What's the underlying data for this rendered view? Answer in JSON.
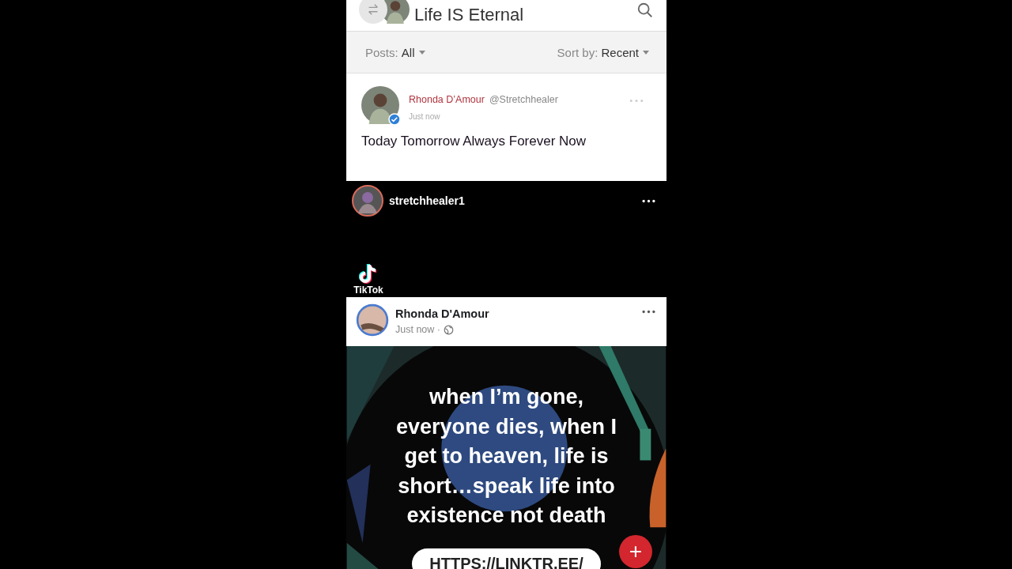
{
  "header": {
    "title": "Life IS Eternal"
  },
  "filters": [
    {
      "label": "Posts:",
      "value": "All"
    },
    {
      "label": "Sort by:",
      "value": "Recent"
    }
  ],
  "post": {
    "author": "Rhonda D’Amour",
    "handle": "@Stretchhealer",
    "time": "Just now",
    "verified": true,
    "text": "Today Tomorrow Always Forever Now"
  },
  "embed": {
    "username": "stretchhealer1",
    "watermark": "TikTok"
  },
  "shared_post": {
    "author": "Rhonda D'Amour",
    "time": "Just now ·",
    "caption_lines": [
      "when I’m gone,",
      "everyone dies, when I",
      "get to heaven, life is",
      "short…speak life into",
      "existence not death"
    ],
    "link": "HTTPS://LINKTR.EE/"
  },
  "fab": {
    "label": "+"
  }
}
